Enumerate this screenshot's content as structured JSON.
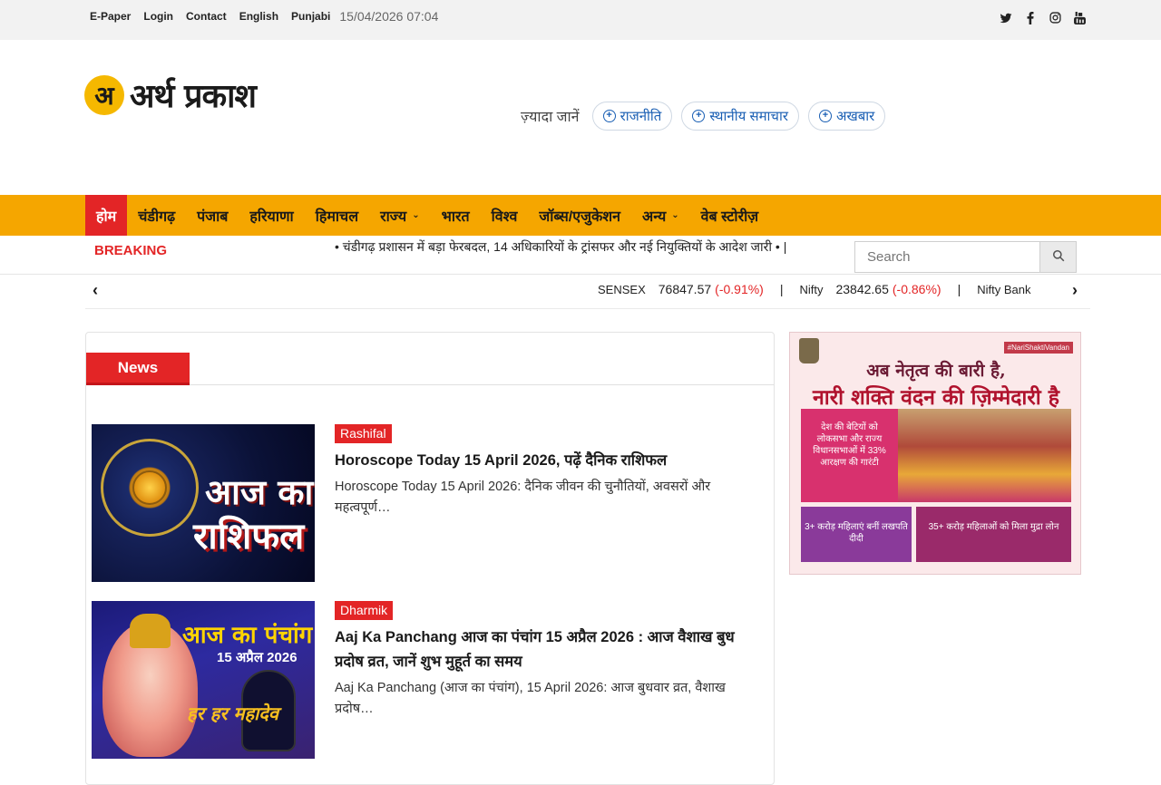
{
  "topbar": {
    "links": [
      "E-Paper",
      "Login",
      "Contact",
      "English",
      "Punjabi"
    ],
    "datetime": "15/04/2026 07:04",
    "social_icons": [
      "twitter-icon",
      "facebook-icon",
      "instagram-icon",
      "youtube-icon"
    ]
  },
  "header": {
    "logo_letter": "अ",
    "logo_text": "अर्थ प्रकाश",
    "more_label": "ज़्यादा जानें",
    "pills": [
      "राजनीति",
      "स्थानीय समाचार",
      "अखबार"
    ]
  },
  "nav": {
    "items": [
      "होम",
      "चंडीगढ़",
      "पंजाब",
      "हरियाणा",
      "हिमाचल",
      "राज्य",
      "भारत",
      "विश्व",
      "जॉब्स/एजुकेशन",
      "अन्य",
      "वेब स्टोरीज़"
    ],
    "active": "होम",
    "dropdown_items": [
      "राज्य",
      "अन्य"
    ]
  },
  "breaking": {
    "label": "BREAKING",
    "ticker": "• चंडीगढ़ प्रशासन में बड़ा फेरबदल, 14 अधिकारियों के ट्रांसफर और नई नियुक्तियों के आदेश जारी • |"
  },
  "search": {
    "placeholder": "Search"
  },
  "market": {
    "items": [
      {
        "name": "SENSEX",
        "value": "76847.57",
        "change": "(-0.91%)"
      },
      {
        "name": "Nifty",
        "value": "23842.65",
        "change": "(-0.86%)"
      },
      {
        "name": "Nifty Bank",
        "value": "",
        "change": ""
      }
    ]
  },
  "news": {
    "tab_label": "News",
    "articles": [
      {
        "category": "Rashifal",
        "title": "Horoscope Today 15 April 2026, पढ़ें दैनिक राशिफल",
        "excerpt": "Horoscope Today 15 April 2026: दैनिक जीवन की चुनौतियों, अवसरों और महत्वपूर्ण…",
        "thumb_line1": "आज का",
        "thumb_line2": "राशिफल"
      },
      {
        "category": "Dharmik",
        "title": "Aaj Ka Panchang आज का पंचांग 15 अप्रैल 2026 : आज वैशाख बुध प्रदोष व्रत, जानें शुभ मुहूर्त का समय",
        "excerpt": "Aaj Ka Panchang (आज का पंचांग), 15 April 2026: आज बुधवार व्रत, वैशाख प्रदोष…",
        "thumb_line1": "आज का पंचांग",
        "thumb_line2": "15 अप्रैल 2026",
        "thumb_line3": "हर हर महादेव"
      }
    ]
  },
  "ad": {
    "hashtag": "#NariShaktiVandan",
    "line1": "अब नेतृत्व की बारी है,",
    "line2": "नारी शक्ति वंदन की ज़िम्मेदारी है",
    "box1": "देश की बेटियों को लोकसभा और राज्य विधानसभाओं में 33% आरक्षण की गारंटी",
    "box2": "3+ करोड़ महिलाएं बनीं लखपति दीदी",
    "box3": "35+ करोड़ महिलाओं को मिला मुद्रा लोन"
  }
}
